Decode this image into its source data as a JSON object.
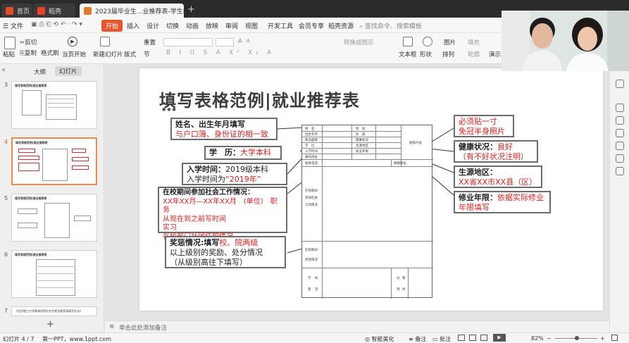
{
  "titlebar": {
    "tab_home": "首页",
    "tab_docer": "稻壳",
    "tab_doc": "2023届毕业生...业推荐表-学生编",
    "new_tab": "+"
  },
  "menubar": {
    "file": "文件",
    "items": [
      "开始",
      "插入",
      "设计",
      "切换",
      "动画",
      "放映",
      "审阅",
      "视图",
      "开发工具",
      "会员专享",
      "稻壳资源"
    ],
    "search": "查找命令、搜索模板"
  },
  "ribbon": {
    "paste": "粘贴",
    "cut": "剪切",
    "copy": "复制",
    "format_painter": "格式刷",
    "from_current": "当页开始",
    "new_slide": "新建幻灯片",
    "layout": "版式",
    "section": "节",
    "reset": "重置",
    "convert_smartart": "转换成图示",
    "textbox": "文本框",
    "shape": "形状",
    "arrange": "排列",
    "picture": "图片",
    "fill": "填充",
    "outline": "轮廓",
    "presentation": "演示工具",
    "font_size_a": "A",
    "font_size_b": "A"
  },
  "leftpanel": {
    "tab_outline": "大纲",
    "tab_slides": "幻灯片",
    "slides": [
      {
        "num": "3",
        "title": "填写表格范例|就业推荐表"
      },
      {
        "num": "4",
        "title": "填写表格范例|就业推荐表"
      },
      {
        "num": "5",
        "title": "填写表格范例|就业推荐表"
      },
      {
        "num": "6",
        "title": "填写表格范例|就业推荐表"
      },
      {
        "num": "7",
        "title": "《北京理工大学珠海学院毕业生就业推荐表填写办法》"
      }
    ],
    "add": "+"
  },
  "slide": {
    "title": "填写表格范例|就业推荐表",
    "dots": "●●●",
    "callouts": {
      "name_dob_title": "姓名、出生年月填写",
      "name_dob_body": "与户口簿、身份证的相一致",
      "education_label": "学　历：",
      "education_value": "大学本科",
      "enroll_title": "入学时间：",
      "enroll_example": "2019级本科",
      "enroll_body": "入学时间为",
      "enroll_value": "“2019年”",
      "work_title": "在校期间参加社会工作情况：",
      "work_line1": "XX年XX月—XX年XX月　(单位)　职务",
      "work_line2": "从现在到之前写时间",
      "work_line3": "实习",
      "work_line4": "在校部门社团任职情况",
      "award_title": "奖惩情况:",
      "award_title2": "填写",
      "award_title_red": "校、院两级",
      "award_line2": "以上级别的奖励、处分情况",
      "award_line3": "（从级别高往下填写）",
      "photo_line1": "必须贴一寸",
      "photo_line2": "免冠半身照片",
      "health_title": "健康状况：",
      "health_value": "良好",
      "health_note": "（有不好状况注明）",
      "origin_title": "生源地区：",
      "origin_value": "XX省XX市XX县（区）",
      "years_title": "修业年限：",
      "years_value": "依据实际修业",
      "years_value2": "年限填写"
    },
    "form": {
      "name": "姓　名",
      "gender": "性　别",
      "birth": "出生年月",
      "ethnic": "民　族",
      "politics": "政治面貌",
      "health": "健康状况",
      "edu": "学　历",
      "origin": "生源地区",
      "enroll": "入学时间",
      "years": "就业年限",
      "major": "通讯地址",
      "photo": "贴照片处",
      "contact": "联系电话",
      "email": "邮箱地址",
      "work1": "在校期间",
      "work2": "参加社会",
      "work3": "工作情况",
      "award1": "在校期间",
      "award2": "奖惩情况",
      "school1": "学",
      "school2": "校",
      "school3": "意",
      "school4": "见",
      "seal1": "分",
      "seal2": "管",
      "seal3": "领",
      "seal4": "导"
    }
  },
  "notes": {
    "placeholder": "单击此处添加备注"
  },
  "status": {
    "slide_counter": "幻灯片 4 / 7",
    "theme": "第一PPT，www.1ppt.com",
    "smart_beautify": "智能美化",
    "notes": "备注",
    "comments": "批注",
    "zoom": "82%"
  }
}
